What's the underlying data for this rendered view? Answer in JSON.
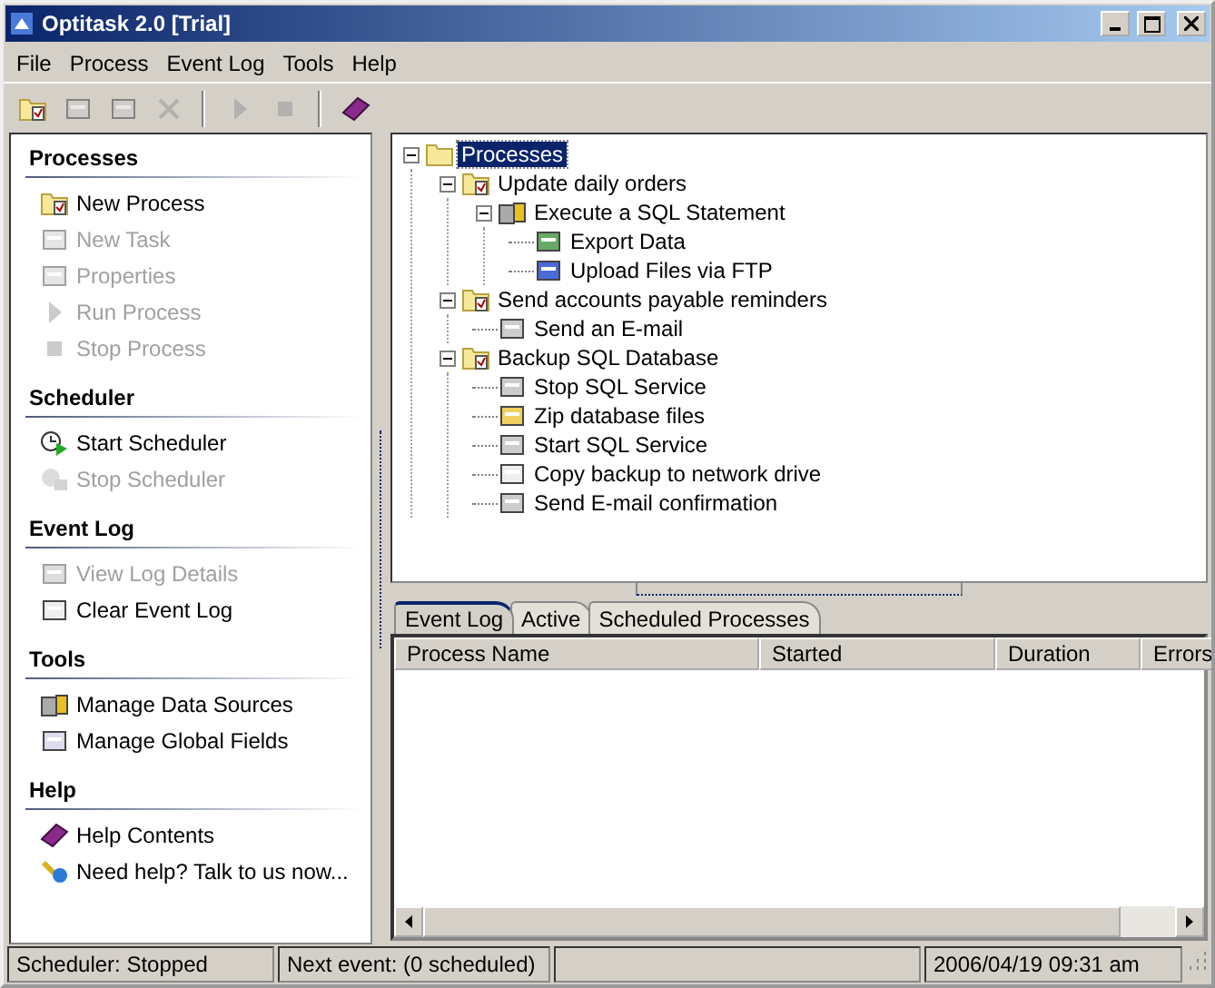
{
  "window": {
    "title": "Optitask 2.0 [Trial]"
  },
  "menu": [
    "File",
    "Process",
    "Event Log",
    "Tools",
    "Help"
  ],
  "toolbar": [
    [
      {
        "disabled": false
      },
      {
        "disabled": true
      },
      {
        "disabled": true
      },
      {
        "disabled": true
      }
    ],
    [
      {
        "disabled": true
      },
      {
        "disabled": true
      }
    ],
    [
      {
        "disabled": false
      }
    ]
  ],
  "sidebar": [
    {
      "title": "Processes",
      "items": [
        {
          "label": "New Process",
          "disabled": false
        },
        {
          "label": "New Task",
          "disabled": true
        },
        {
          "label": "Properties",
          "disabled": true
        },
        {
          "label": "Run Process",
          "disabled": true
        },
        {
          "label": "Stop Process",
          "disabled": true
        }
      ]
    },
    {
      "title": "Scheduler",
      "items": [
        {
          "label": "Start Scheduler",
          "disabled": false
        },
        {
          "label": "Stop Scheduler",
          "disabled": true
        }
      ]
    },
    {
      "title": "Event Log",
      "items": [
        {
          "label": "View Log Details",
          "disabled": true
        },
        {
          "label": "Clear Event Log",
          "disabled": false
        }
      ]
    },
    {
      "title": "Tools",
      "items": [
        {
          "label": "Manage Data Sources",
          "disabled": false
        },
        {
          "label": "Manage Global Fields",
          "disabled": false
        }
      ]
    },
    {
      "title": "Help",
      "items": [
        {
          "label": "Help Contents",
          "disabled": false
        },
        {
          "label": "Need help? Talk to us now...",
          "disabled": false
        }
      ]
    }
  ],
  "tree": [
    {
      "label": "Processes",
      "selected": true,
      "expanded": true,
      "children": [
        {
          "label": "Update daily orders",
          "selected": false,
          "expanded": true,
          "children": [
            {
              "label": "Execute a SQL Statement",
              "selected": false,
              "expanded": true,
              "children": [
                {
                  "label": "Export Data",
                  "selected": false
                },
                {
                  "label": "Upload Files via FTP",
                  "selected": false
                }
              ]
            }
          ]
        },
        {
          "label": "Send accounts payable reminders",
          "selected": false,
          "expanded": true,
          "children": [
            {
              "label": "Send an E-mail",
              "selected": false
            }
          ]
        },
        {
          "label": "Backup SQL Database",
          "selected": false,
          "expanded": true,
          "children": [
            {
              "label": "Stop SQL Service",
              "selected": false
            },
            {
              "label": "Zip database files",
              "selected": false
            },
            {
              "label": "Start SQL Service",
              "selected": false
            },
            {
              "label": "Copy backup to network drive",
              "selected": false
            },
            {
              "label": "Send E-mail confirmation",
              "selected": false
            }
          ]
        }
      ]
    }
  ],
  "tabs": [
    {
      "label": "Event Log",
      "selected": true
    },
    {
      "label": "Active",
      "selected": false
    },
    {
      "label": "Scheduled Processes",
      "selected": false
    }
  ],
  "table": {
    "columns": [
      "Process Name",
      "Started",
      "Duration",
      "Errors"
    ]
  },
  "status_bar": [
    "Scheduler: Stopped",
    "Next event: (0 scheduled)",
    "2006/04/19 09:31 am"
  ]
}
